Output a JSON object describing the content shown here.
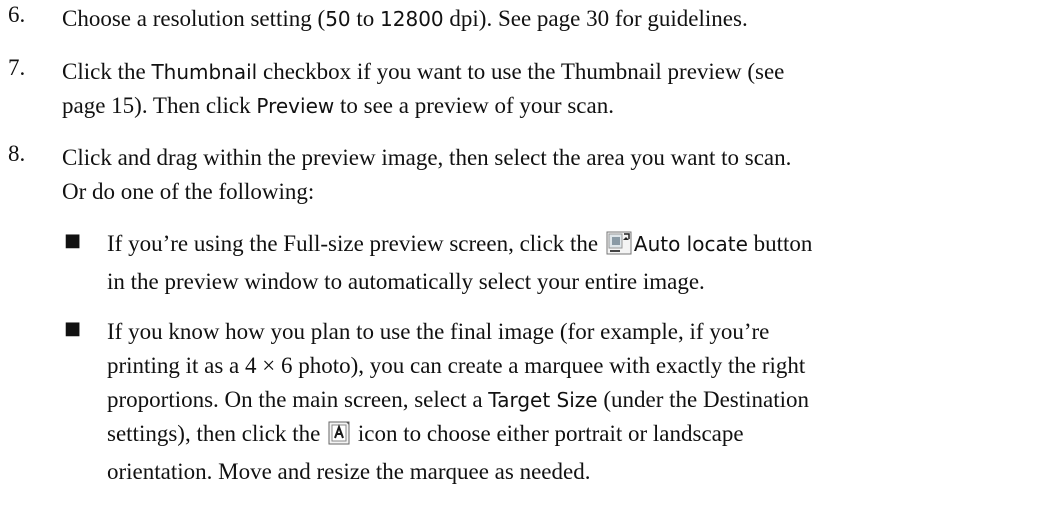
{
  "step6": {
    "number": "6.",
    "a": "Choose a resolution setting (",
    "min": "50",
    "to": " to ",
    "max": "12800",
    "b": " dpi). See page 30 for guidelines."
  },
  "step7": {
    "number": "7.",
    "a": "Click the ",
    "thumbnail": "Thumbnail",
    "b": " checkbox if you want to use the Thumbnail preview (see",
    "c": "page 15). Then click ",
    "preview": "Preview",
    "d": " to see a preview of your scan."
  },
  "step8": {
    "number": "8.",
    "a": "Click and drag within the preview image, then select the area you want to scan.",
    "b": "Or do one of the following:"
  },
  "bullet1": {
    "mark": "■",
    "a": "If you’re using the Full-size preview screen, click the ",
    "auto_locate": "Auto locate",
    "b": " button",
    "c": "in the preview window to automatically select your entire image."
  },
  "bullet2": {
    "mark": "■",
    "line1": "If you know how you plan to use the final image (for example, if you’re",
    "line2": "printing it as a 4 × 6 photo), you can create a marquee with exactly the right",
    "line3a": "proportions. On the main screen, select a ",
    "target_size": "Target Size",
    "line3b": " (under the Destination",
    "line4a": "settings), then click the ",
    "line4b": " icon to choose either portrait or landscape",
    "line5": "orientation. Move and resize the marquee as needed."
  },
  "icons": {
    "auto_locate": "auto-locate-icon",
    "orientation": "orientation-icon"
  }
}
